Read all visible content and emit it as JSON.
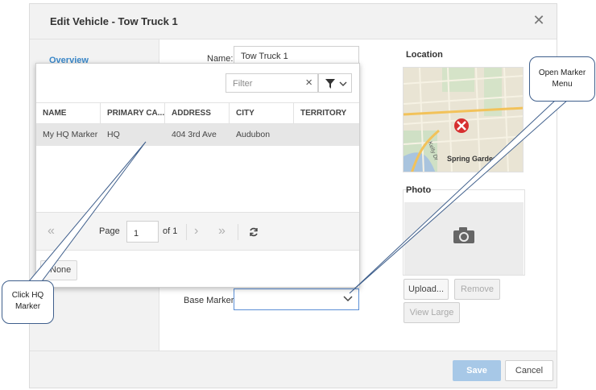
{
  "dialog": {
    "title": "Edit Vehicle - Tow Truck 1",
    "close_icon": "close-icon"
  },
  "side_nav": {
    "items": [
      {
        "label": "Overview"
      }
    ]
  },
  "form": {
    "name_label": "Name:",
    "name_value": "Tow Truck 1",
    "base_marker_label": "Base Marker:",
    "base_marker_value": ""
  },
  "location": {
    "label": "Location",
    "map_text": "Spring Garden",
    "map_street": "Kelly Dr"
  },
  "photo": {
    "label": "Photo",
    "upload_label": "Upload...",
    "remove_label": "Remove",
    "view_large_label": "View Large"
  },
  "popup": {
    "filter_placeholder": "Filter",
    "columns": [
      "NAME",
      "PRIMARY CA...",
      "ADDRESS",
      "CITY",
      "TERRITORY"
    ],
    "rows": [
      {
        "name": "My HQ Marker",
        "primary": "HQ",
        "address": "404 3rd Ave",
        "city": "Audubon",
        "territory": ""
      }
    ],
    "pager": {
      "page_label": "Page",
      "page_value": "1",
      "of_label": "of 1"
    },
    "none_label": "None"
  },
  "footer": {
    "save_label": "Save",
    "cancel_label": "Cancel"
  },
  "callouts": {
    "hq": {
      "line1": "Click HQ",
      "line2": "Marker"
    },
    "menu": {
      "line1": "Open Marker",
      "line2": "Menu"
    }
  },
  "colors": {
    "accent": "#3a87c8",
    "save_button": "#a7c8e7",
    "focus_border": "#5b8fd6",
    "callout_border": "#3f5f8c"
  }
}
